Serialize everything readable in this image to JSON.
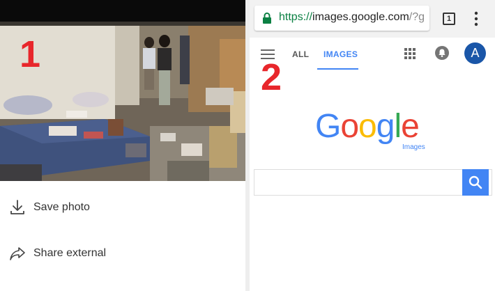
{
  "left": {
    "step_number": "1",
    "menu": [
      {
        "label": "Save photo",
        "icon": "download-icon"
      },
      {
        "label": "Share external",
        "icon": "share-icon"
      }
    ]
  },
  "right": {
    "step_number": "2",
    "browser": {
      "url_scheme": "https://",
      "url_host": "images.google.com",
      "url_rest": "/?g",
      "tab_count": "1"
    },
    "nav": {
      "tabs": [
        "ALL",
        "IMAGES"
      ],
      "active_tab": "IMAGES"
    },
    "avatar_letter": "A",
    "logo": {
      "word": [
        "G",
        "o",
        "o",
        "g",
        "l",
        "e"
      ],
      "sub": "Images"
    },
    "search": {
      "value": "",
      "placeholder": ""
    }
  },
  "colors": {
    "accent_blue": "#4285f4",
    "google_red": "#ea4335",
    "google_yellow": "#fbbc05",
    "google_green": "#34a853",
    "url_green": "#0b8043",
    "step_red": "#e8262b",
    "avatar_bg": "#1a56a8"
  }
}
